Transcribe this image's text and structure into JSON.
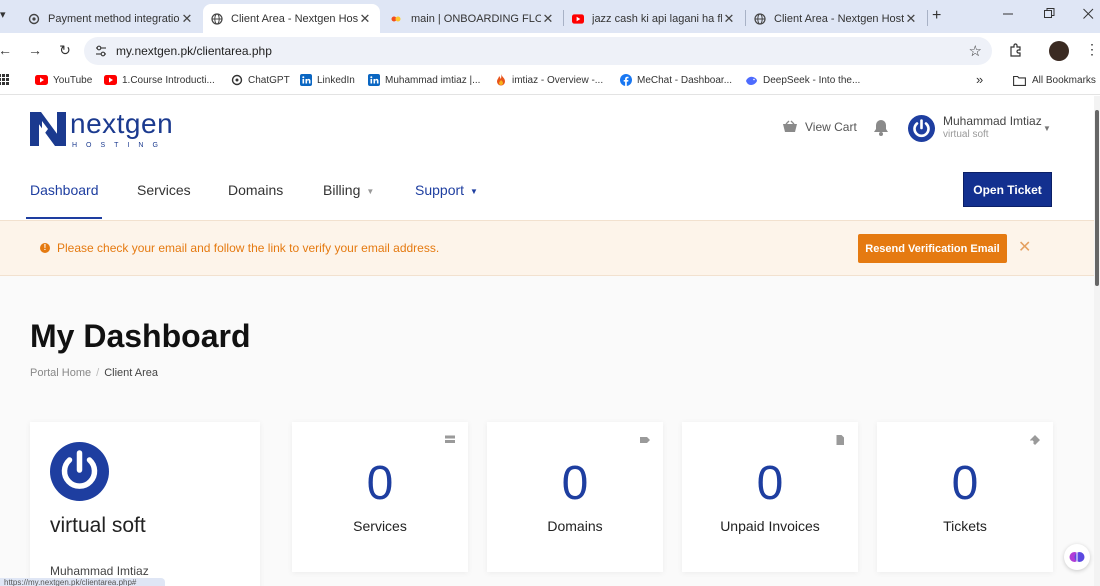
{
  "browser": {
    "tabs": [
      {
        "title": "Payment method integratio",
        "icon": "gear-icon"
      },
      {
        "title": "Client Area - Nextgen Hostin",
        "icon": "globe-icon",
        "active": true
      },
      {
        "title": "main | ONBOARDING FLOW",
        "icon": "figma-icon"
      },
      {
        "title": "jazz cash ki api lagani ha flu",
        "icon": "youtube-icon"
      },
      {
        "title": "Client Area - Nextgen Hostin",
        "icon": "globe-icon"
      }
    ],
    "tab_close": "✕",
    "new_tab": "+",
    "address": "my.nextgen.pk/clientarea.php",
    "bookmarks": [
      {
        "label": "YouTube",
        "icon": "youtube-icon"
      },
      {
        "label": "1.Course Introducti...",
        "icon": "youtube-icon"
      },
      {
        "label": "ChatGPT",
        "icon": "chatgpt-icon"
      },
      {
        "label": "LinkedIn",
        "icon": "linkedin-icon"
      },
      {
        "label": "Muhammad imtiaz |...",
        "icon": "linkedin-icon"
      },
      {
        "label": "imtiaz - Overview -...",
        "icon": "flame-icon"
      },
      {
        "label": "MeChat - Dashboar...",
        "icon": "facebook-icon"
      },
      {
        "label": "DeepSeek - Into the...",
        "icon": "deepseek-icon"
      }
    ],
    "bookmarks_more": "»",
    "all_bookmarks": "All Bookmarks",
    "status_url": "https://my.nextgen.pk/clientarea.php#"
  },
  "header": {
    "logo_word": "nextgen",
    "logo_sub": "HOSTING",
    "view_cart": "View Cart",
    "user_name": "Muhammad Imtiaz",
    "user_company": "virtual soft"
  },
  "nav": {
    "items": [
      {
        "label": "Dashboard",
        "active": true
      },
      {
        "label": "Services"
      },
      {
        "label": "Domains"
      },
      {
        "label": "Billing",
        "dropdown": true
      },
      {
        "label": "Support",
        "dropdown": true
      }
    ],
    "caret": "▼",
    "open_ticket": "Open Ticket"
  },
  "alert": {
    "icon": "!",
    "message": "Please check your email and follow the link to verify your email address.",
    "button": "Resend Verification Email",
    "close": "✕"
  },
  "page": {
    "title": "My Dashboard",
    "breadcrumb": {
      "home": "Portal Home",
      "sep": "/",
      "current": "Client Area"
    }
  },
  "profile_card": {
    "company": "virtual soft",
    "name": "Muhammad Imtiaz"
  },
  "stats": [
    {
      "label": "Services",
      "value": "0",
      "icon": "server-icon"
    },
    {
      "label": "Domains",
      "value": "0",
      "icon": "tag-icon"
    },
    {
      "label": "Unpaid Invoices",
      "value": "0",
      "icon": "document-icon"
    },
    {
      "label": "Tickets",
      "value": "0",
      "icon": "ticket-icon"
    }
  ],
  "colors": {
    "brand": "#1e3ea0",
    "alert": "#e57a11"
  }
}
